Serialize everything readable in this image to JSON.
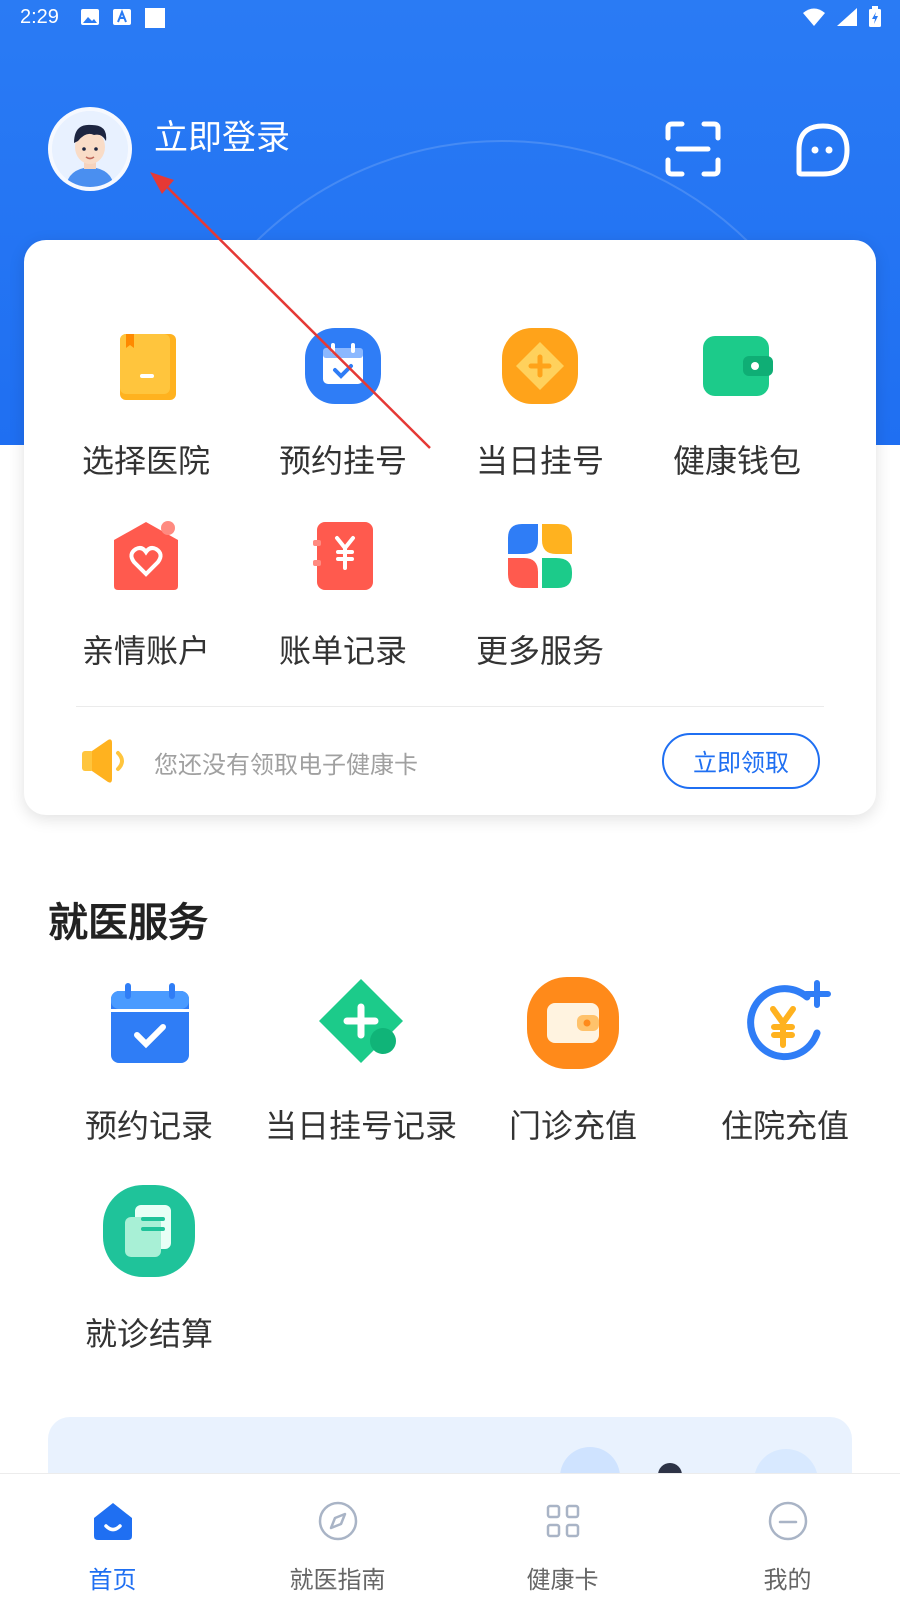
{
  "status_bar": {
    "time": "2:29"
  },
  "header": {
    "login_label": "立即登录"
  },
  "quick_actions": [
    {
      "label": "选择医院",
      "icon": "hospital-book-icon"
    },
    {
      "label": "预约挂号",
      "icon": "calendar-check-icon"
    },
    {
      "label": "当日挂号",
      "icon": "diamond-plus-icon"
    },
    {
      "label": "健康钱包",
      "icon": "wallet-icon"
    },
    {
      "label": "亲情账户",
      "icon": "heart-home-icon"
    },
    {
      "label": "账单记录",
      "icon": "yuan-bill-icon"
    },
    {
      "label": "更多服务",
      "icon": "grid-dots-icon"
    }
  ],
  "health_card_hint": {
    "text": "您还没有领取电子健康卡",
    "button": "立即领取"
  },
  "medical_services": {
    "title": "就医服务",
    "items": [
      {
        "label": "预约记录",
        "icon": "calendar-check-icon"
      },
      {
        "label": "当日挂号记录",
        "icon": "diamond-plus-icon"
      },
      {
        "label": "门诊充值",
        "icon": "wallet-icon"
      },
      {
        "label": "住院充值",
        "icon": "yuan-circle-plus-icon"
      },
      {
        "label": "就诊结算",
        "icon": "receipt-icon"
      }
    ]
  },
  "tabbar": {
    "tabs": [
      {
        "label": "首页",
        "icon": "home-icon",
        "active": true
      },
      {
        "label": "就医指南",
        "icon": "compass-icon",
        "active": false
      },
      {
        "label": "健康卡",
        "icon": "qr-grid-icon",
        "active": false
      },
      {
        "label": "我的",
        "icon": "user-circle-icon",
        "active": false
      }
    ]
  },
  "colors": {
    "primary": "#1f6ff2",
    "annotation_arrow": "#e53935"
  }
}
